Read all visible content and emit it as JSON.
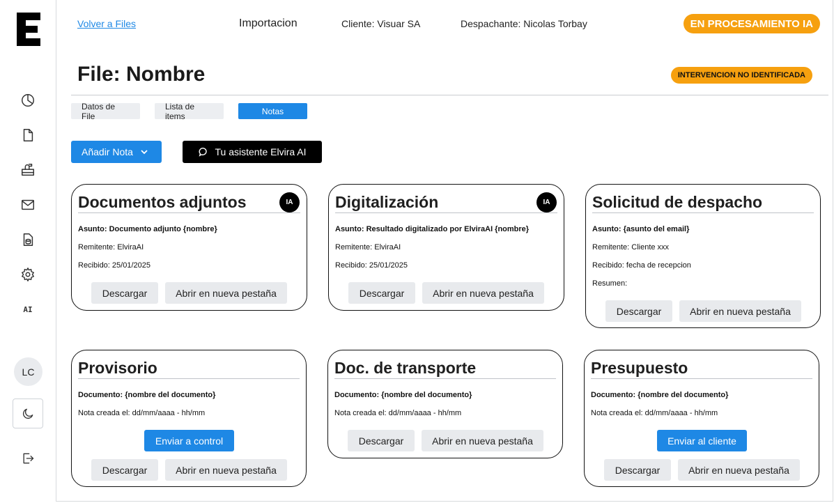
{
  "app": {
    "logo_letter": "E",
    "icons": [
      "pie-chart-icon",
      "document-icon",
      "mailbox-icon",
      "mail-icon",
      "file-database-icon",
      "gear-icon",
      "ai-icon"
    ],
    "ai_label": "AI"
  },
  "user": {
    "initials": "LC"
  },
  "header": {
    "back_link": "Volver a Files",
    "type": "Importacion",
    "client": "Cliente: Visuar SA",
    "dispatcher": "Despachante: Nicolas Torbay",
    "status": "EN PROCESAMIENTO IA"
  },
  "page": {
    "title": "File: Nombre",
    "warning": "INTERVENCION NO IDENTIFICADA"
  },
  "tabs": [
    {
      "label": "Datos de File",
      "active": false
    },
    {
      "label": "Lista de items",
      "active": false
    },
    {
      "label": "Notas",
      "active": true
    }
  ],
  "actions": {
    "add_note": "Añadir Nota",
    "assistant": "Tu asistente Elvira AI"
  },
  "cards": [
    {
      "title": "Documentos adjuntos",
      "badge": "IA",
      "lines": [
        "Asunto: Documento adjunto {nombre}",
        "Remitente: ElviraAI",
        "Recibido: 25/01/2025"
      ],
      "download": "Descargar",
      "open": "Abrir en nueva pestaña"
    },
    {
      "title": "Digitalización",
      "badge": "IA",
      "lines": [
        "Asunto: Resultado digitalizado por ElviraAI {nombre}",
        "Remitente: ElviraAI",
        "Recibido: 25/01/2025"
      ],
      "download": "Descargar",
      "open": "Abrir en nueva pestaña"
    },
    {
      "title": "Solicitud de despacho",
      "lines": [
        "Asunto: {asunto del email}",
        "Remitente: Cliente xxx",
        "Recibido: fecha de recepcion",
        "Resumen:"
      ],
      "download": "Descargar",
      "open": "Abrir en nueva pestaña"
    },
    {
      "title": "Provisorio",
      "lines": [
        "Documento: {nombre del documento}",
        "Nota creada el: dd/mm/aaaa - hh/mm"
      ],
      "primary": "Enviar a control",
      "download": "Descargar",
      "open": "Abrir en nueva pestaña"
    },
    {
      "title": "Doc. de transporte",
      "lines": [
        "Documento: {nombre del documento}",
        "Nota creada el: dd/mm/aaaa - hh/mm"
      ],
      "download": "Descargar",
      "open": "Abrir en nueva pestaña"
    },
    {
      "title": "Presupuesto",
      "lines": [
        "Documento: {nombre del documento}",
        "Nota creada el: dd/mm/aaaa - hh/mm"
      ],
      "primary": "Enviar al cliente",
      "download": "Descargar",
      "open": "Abrir en nueva pestaña"
    }
  ],
  "colors": {
    "accent": "#1e88e5",
    "status": "#f6a00f",
    "dark": "#000000"
  }
}
